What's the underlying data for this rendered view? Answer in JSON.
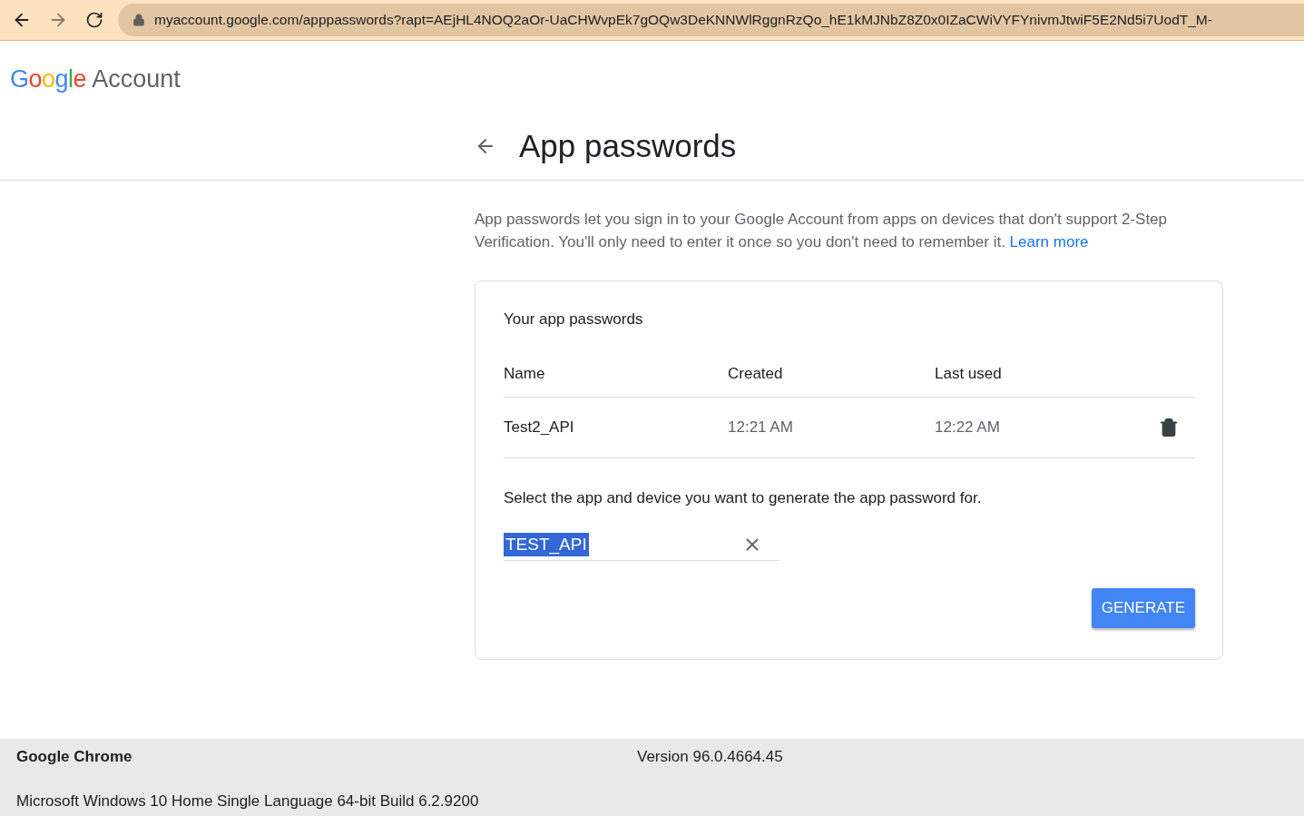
{
  "browser": {
    "url": "myaccount.google.com/apppasswords?rapt=AEjHL4NOQ2aOr-UaCHWvpEk7gOQw3DeKNNWlRggnRzQo_hE1kMJNbZ8Z0x0IZaCWiVYFYnivmJtwiF5E2Nd5i7UodT_M-"
  },
  "header": {
    "logo": "Google",
    "product": "Account"
  },
  "page": {
    "title": "App passwords",
    "intro": "App passwords let you sign in to your Google Account from apps on devices that don't support 2-Step Verification. You'll only need to enter it once so you don't need to remember it.",
    "learn_more": "Learn more"
  },
  "card": {
    "heading": "Your app passwords",
    "columns": [
      "Name",
      "Created",
      "Last used"
    ],
    "rows": [
      {
        "name": "Test2_API",
        "created": "12:21 AM",
        "last_used": "12:22 AM"
      }
    ],
    "prompt": "Select the app and device you want to generate the app password for.",
    "field": {
      "value": "TEST_API",
      "selected_text": true
    },
    "button": "GENERATE"
  },
  "footer": {
    "browser_name": "Google Chrome",
    "version": "Version 96.0.4664.45",
    "os": "Microsoft Windows 10 Home Single Language 64-bit Build 6.2.9200"
  }
}
